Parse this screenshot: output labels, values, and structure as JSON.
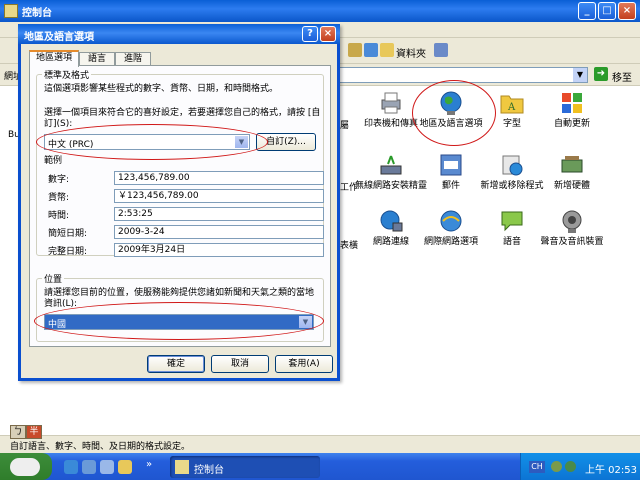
{
  "control_panel": {
    "title": "控制台",
    "toolbar": {
      "folders_label": "資料夾"
    },
    "address": {
      "label": "網址",
      "go_label": "移至"
    },
    "partial_labels": [
      "Bu",
      "屬",
      "工作",
      "表橫",
      "工具"
    ],
    "items": [
      {
        "label": "印表機和傳真",
        "icon": "printer-icon"
      },
      {
        "label": "地區及語言選項",
        "icon": "globe-icon"
      },
      {
        "label": "字型",
        "icon": "fonts-folder-icon"
      },
      {
        "label": "自動更新",
        "icon": "windows-update-icon"
      },
      {
        "label": "無線網路安裝精靈",
        "icon": "wireless-icon"
      },
      {
        "label": "郵件",
        "icon": "mail-icon"
      },
      {
        "label": "新增或移除程式",
        "icon": "add-remove-icon"
      },
      {
        "label": "新增硬體",
        "icon": "add-hardware-icon"
      },
      {
        "label": "網路連線",
        "icon": "network-icon"
      },
      {
        "label": "網際網路選項",
        "icon": "internet-options-icon"
      },
      {
        "label": "語音",
        "icon": "speech-icon"
      },
      {
        "label": "聲音及音訊裝置",
        "icon": "speaker-icon"
      }
    ],
    "status_text": "自訂語言、數字、時間、及日期的格式設定。"
  },
  "ime_toolbar": {
    "mode_label": "ㄅ",
    "width_label": "半"
  },
  "dialog": {
    "title": "地區及語言選項",
    "help_label": "?",
    "close_label": "×",
    "tabs": [
      {
        "label": "地區選項",
        "active": true
      },
      {
        "label": "語言",
        "active": false
      },
      {
        "label": "進階",
        "active": false
      }
    ],
    "standards": {
      "group_title": "標準及格式",
      "description": "這個選項影響某些程式的數字、貨幣、日期，和時間格式。",
      "select_prompt": "選擇一個項目來符合它的喜好設定，若要選擇您自己的格式，請按 [自訂](S):",
      "format_value": "中文 (PRC)",
      "customize_label": "自訂(Z)..."
    },
    "samples": {
      "title": "範例",
      "rows": [
        {
          "label": "數字:",
          "value": "123,456,789.00"
        },
        {
          "label": "貨幣:",
          "value": "￥123,456,789.00"
        },
        {
          "label": "時間:",
          "value": "2:53:25"
        },
        {
          "label": "簡短日期:",
          "value": "2009-3-24"
        },
        {
          "label": "完整日期:",
          "value": "2009年3月24日"
        }
      ]
    },
    "location": {
      "group_title": "位置",
      "description": "請選擇您目前的位置，使服務能夠提供您諸如新聞和天氣之類的當地資訊(L):",
      "value": "中國"
    },
    "buttons": {
      "ok": "確定",
      "cancel": "取消",
      "apply": "套用(A)"
    }
  },
  "taskbar": {
    "task_label": "控制台",
    "tray_lang": "CH",
    "clock": "上午 02:53"
  },
  "colors": {
    "xp_blue": "#0a5fd6",
    "dialog_bg": "#ece9d8",
    "selection": "#316ac5",
    "annotation_red": "#d01818",
    "start_green": "#3d8d3a"
  }
}
